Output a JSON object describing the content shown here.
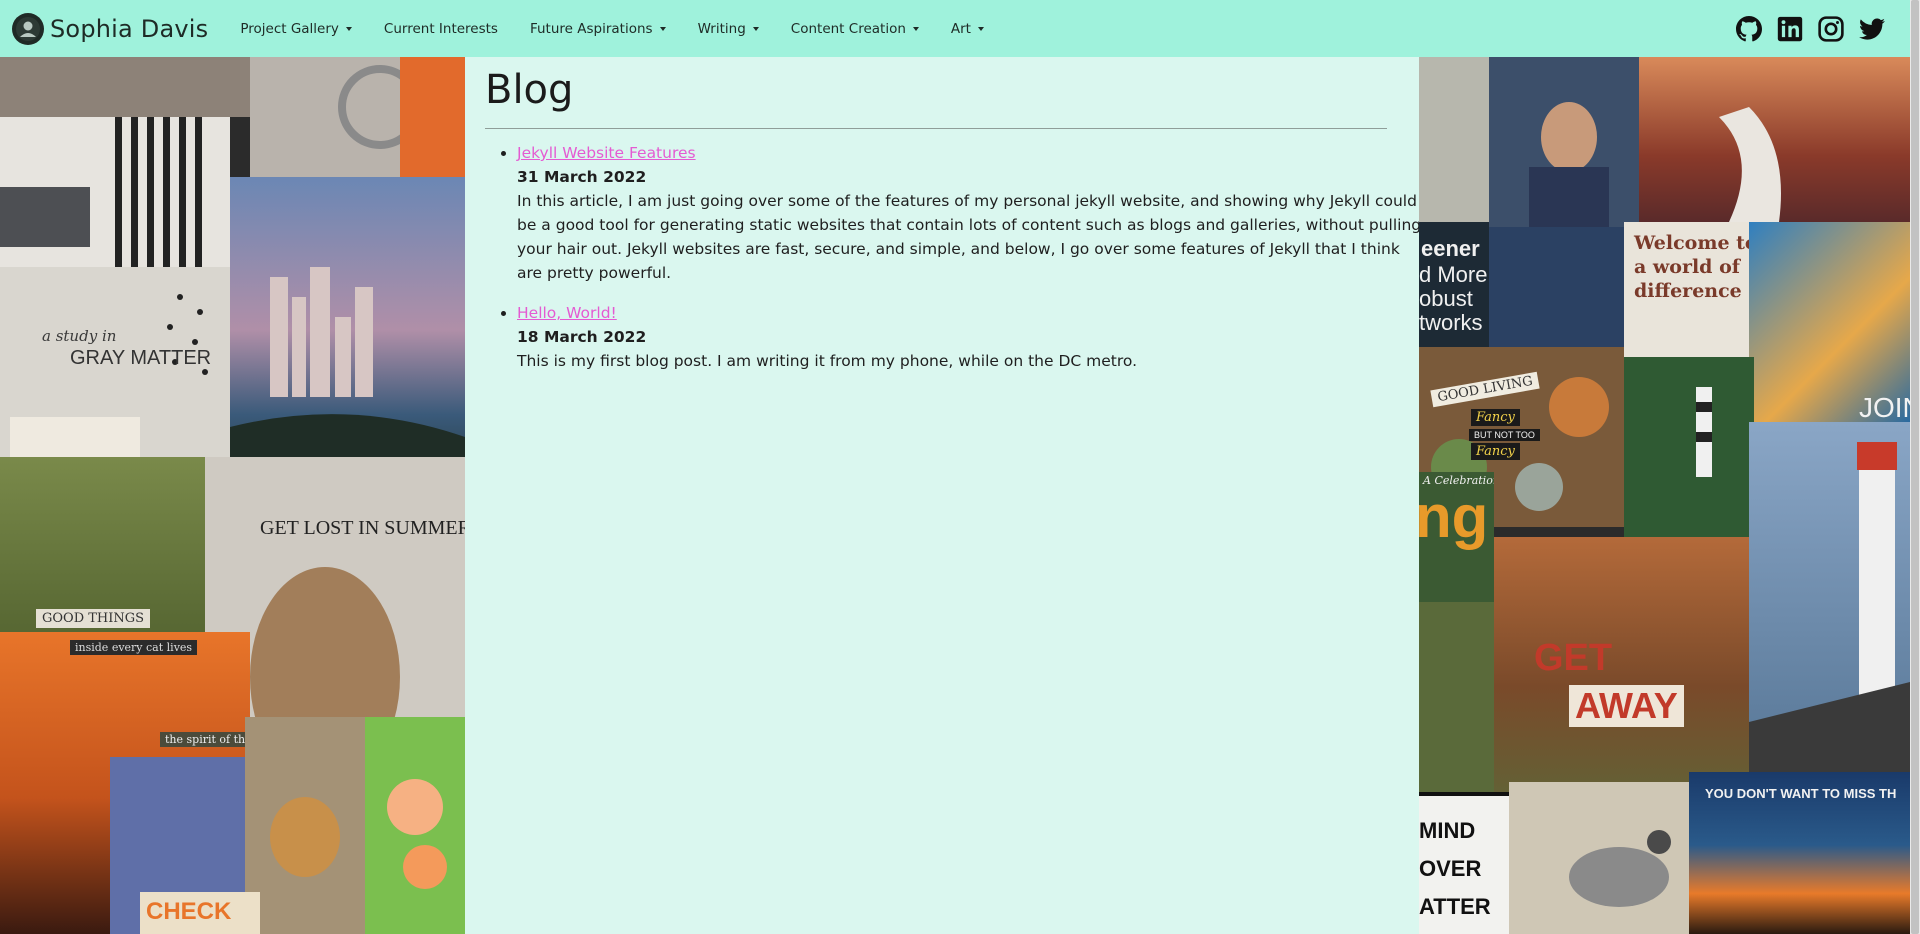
{
  "brand": {
    "name": "Sophia Davis",
    "avatar_icon": "avatar-icon"
  },
  "nav": {
    "items": [
      {
        "label": "Project Gallery",
        "dropdown": true
      },
      {
        "label": "Current Interests",
        "dropdown": false
      },
      {
        "label": "Future Aspirations",
        "dropdown": true
      },
      {
        "label": "Writing",
        "dropdown": true
      },
      {
        "label": "Content Creation",
        "dropdown": true
      },
      {
        "label": "Art",
        "dropdown": true
      }
    ]
  },
  "social": [
    "github-icon",
    "linkedin-icon",
    "instagram-icon",
    "twitter-icon"
  ],
  "colors": {
    "navbar": "#9ff2dc",
    "content_bg": "#daf7ef",
    "link": "#e45bd2",
    "text": "#1f1f1f"
  },
  "page": {
    "title": "Blog",
    "posts": [
      {
        "title": "Jekyll Website Features",
        "date": "31 March 2022",
        "excerpt": "In this article, I am just going over some of the features of my personal jekyll website, and showing why Jekyll could be a good tool for generating static websites that contain lots of content such as blogs and galleries, without pulling your hair out. Jekyll websites are fast, secure, and simple, and below, I go over some features of Jekyll that I think are pretty powerful."
      },
      {
        "title": "Hello, World!",
        "date": "18 March 2022",
        "excerpt": "This is my first blog post. I am writing it from my phone, while on the DC metro."
      }
    ]
  },
  "collage_text": {
    "left": [
      "a study in",
      "GRAY MATTER",
      "GET LOST IN SUMMER",
      "GOOD THINGS",
      "inside every cat lives",
      "the spirit of the wild.",
      "CHECK"
    ],
    "right": [
      "eener",
      "d More",
      "obust",
      "tworks",
      "Welcome to",
      "a world of",
      "difference",
      "GOOD LIVING",
      "Fancy",
      "BUT NOT TOO",
      "Fancy",
      "JOIN",
      "ng",
      "A Celebration of",
      "GET",
      "AWAY",
      "YOU DON'T WANT TO MISS TH",
      "MIND",
      "OVER",
      "ATTER"
    ]
  }
}
